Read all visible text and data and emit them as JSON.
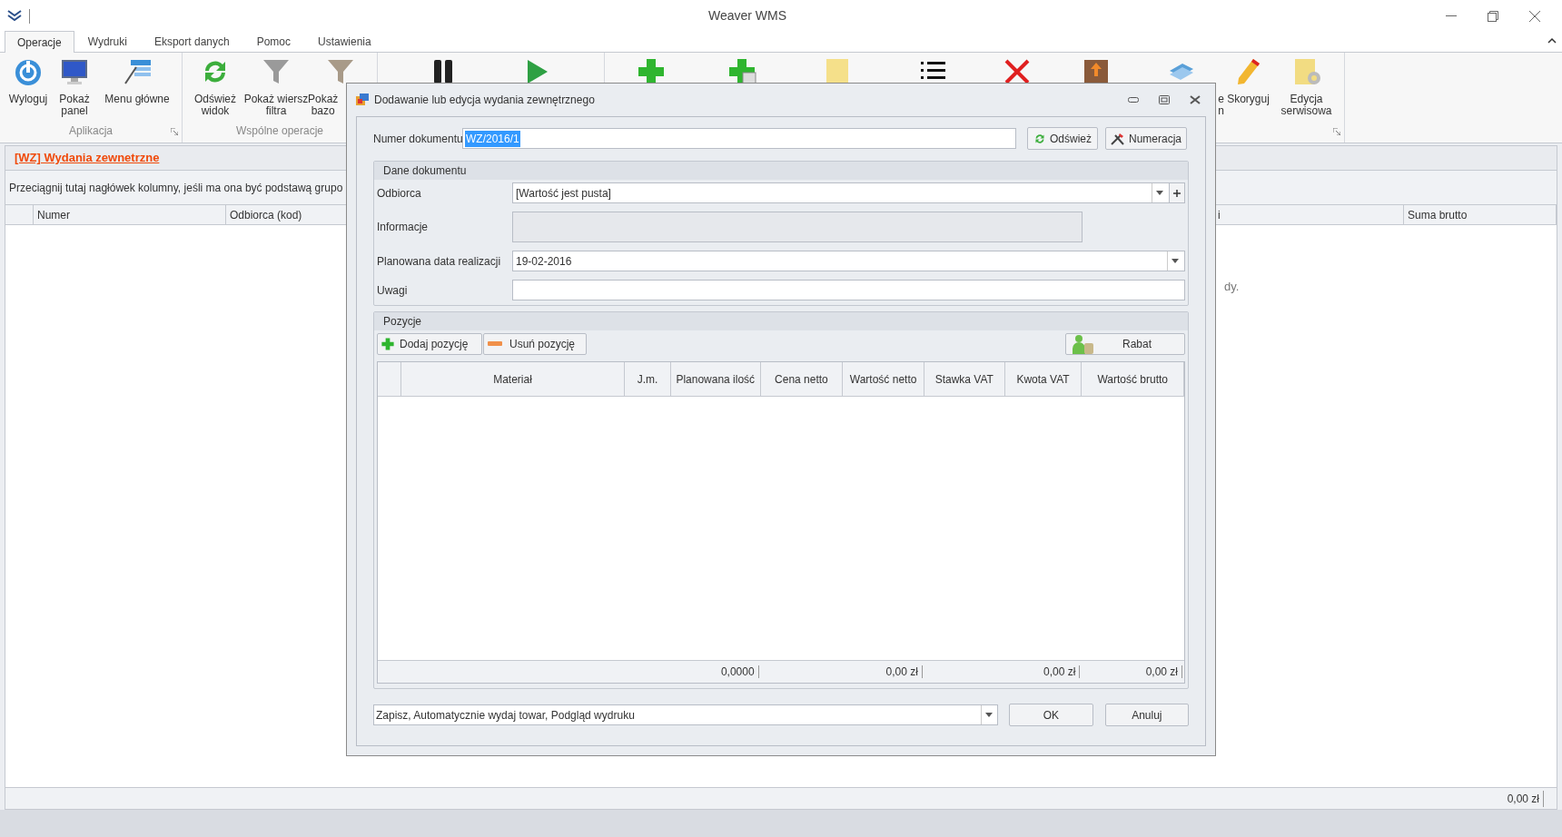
{
  "window": {
    "title": "Weaver WMS"
  },
  "ribbon_tabs": [
    {
      "label": "Operacje",
      "selected": true
    },
    {
      "label": "Wydruki",
      "selected": false
    },
    {
      "label": "Eksport danych",
      "selected": false
    },
    {
      "label": "Pomoc",
      "selected": false
    },
    {
      "label": "Ustawienia",
      "selected": false
    }
  ],
  "ribbon_groups": [
    {
      "label": "Aplikacja",
      "items": [
        {
          "kind": "labeled",
          "lines": [
            "Wyloguj"
          ]
        },
        {
          "kind": "labeled",
          "lines": [
            "Pokaż",
            "panel"
          ]
        },
        {
          "kind": "labeled",
          "lines": [
            "Menu główne"
          ]
        }
      ]
    },
    {
      "label": "Wspólne operacje",
      "items": [
        {
          "kind": "labeled",
          "lines": [
            "Odśwież",
            "widok"
          ]
        },
        {
          "kind": "labeled",
          "lines": [
            "Pokaż wiersz",
            "filtra"
          ]
        },
        {
          "kind": "labeled",
          "lines": [
            "Pokaż",
            "bazo"
          ]
        }
      ]
    },
    {
      "items": [
        {
          "kind": "icon"
        },
        {
          "kind": "icon"
        }
      ]
    },
    {
      "items": [
        {
          "kind": "icon"
        },
        {
          "kind": "icon"
        },
        {
          "kind": "icon"
        },
        {
          "kind": "icon"
        },
        {
          "kind": "icon"
        },
        {
          "kind": "icon"
        },
        {
          "kind": "labeled",
          "lines": [
            "e",
            "n"
          ]
        },
        {
          "kind": "labeled",
          "lines": [
            "Skoryguj"
          ]
        },
        {
          "kind": "labeled",
          "lines": [
            "Edycja",
            "serwisowa"
          ]
        }
      ]
    }
  ],
  "document_tab": "[WZ] Wydania zewnetrzne",
  "group_by_hint": "Przeciągnij tutaj nagłówek kolumny, jeśli ma ona być podstawą grupo",
  "columns": [
    "Numer",
    "Odbiorca (kod)",
    "i",
    "Suma brutto"
  ],
  "empty_message": "dy.",
  "footer_total": "0,00 zł",
  "dialog": {
    "title": "Dodawanie lub edycja wydania zewnętrznego",
    "number": {
      "label": "Numer dokumentu",
      "value": "WZ/2016/1",
      "text_selected": true
    },
    "number_buttons": [
      "Odśwież",
      "Numeracja"
    ],
    "details": {
      "title": "Dane dokumentu",
      "fields": [
        {
          "label": "Odbiorca",
          "value": "[Wartość jest pusta]",
          "kind": "combo_add"
        },
        {
          "label": "Informacje",
          "kind": "readonly"
        },
        {
          "label": "Planowana data realizacji",
          "value": "19-02-2016",
          "kind": "date"
        },
        {
          "label": "Uwagi",
          "kind": "text"
        }
      ]
    },
    "positions": {
      "title": "Pozycje",
      "add": "Dodaj pozycję",
      "remove": "Usuń pozycję",
      "discount": "Rabat",
      "columns": [
        "Materiał",
        "J.m.",
        "Planowana ilość",
        "Cena netto",
        "Wartość netto",
        "Stawka VAT",
        "Kwota VAT",
        "Wartość brutto"
      ],
      "totals": {
        "quantity": "0,0000",
        "net": "0,00 zł",
        "vat": "0,00 zł",
        "gross": "0,00 zł"
      }
    },
    "action": "Zapisz, Automatycznie wydaj towar, Podgląd wydruku",
    "ok": "OK",
    "cancel": "Anuluj"
  }
}
